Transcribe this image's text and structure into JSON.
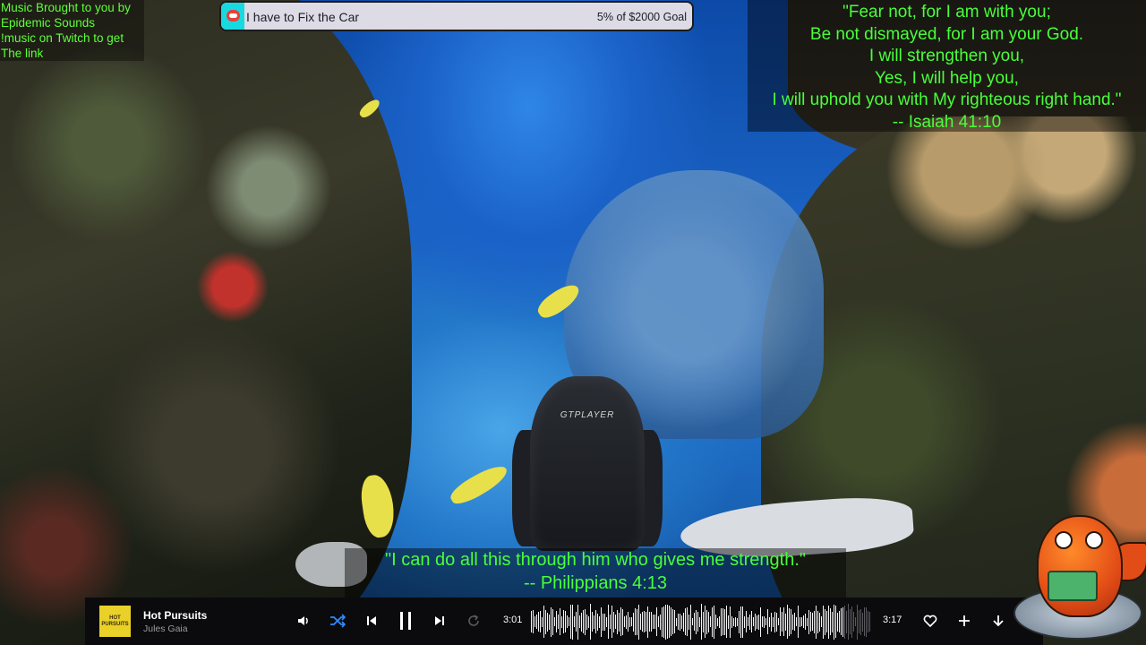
{
  "credits": {
    "lines": [
      "Music Brought to you by",
      "Epidemic Sounds",
      "!music on Twitch to get",
      "The link"
    ]
  },
  "goal": {
    "title": "I have to Fix the Car",
    "progress_text": "5% of $2000 Goal",
    "percent": 5,
    "icon": "heart-chat-icon"
  },
  "verse_top": {
    "lines": [
      "\"Fear not, for I am with you;",
      "Be not dismayed, for I am your God.",
      "I will strengthen you,",
      "Yes, I will help you,",
      "I will uphold you with My righteous right hand.\"",
      "-- Isaiah 41:10"
    ]
  },
  "verse_bottom": {
    "lines": [
      "\"I can do all this through him who gives me strength.\"",
      "-- Philippians 4:13"
    ]
  },
  "chair": {
    "brand": "GTPLAYER"
  },
  "player": {
    "album_art_text": "HOT PURSUITS",
    "song_title": "Hot Pursuits",
    "artist": "Jules Gaia",
    "elapsed": "3:01",
    "duration": "3:17",
    "progress_fraction": 0.92,
    "icons": {
      "volume": "volume-icon",
      "shuffle": "shuffle-icon",
      "previous": "previous-track-icon",
      "pause": "pause-icon",
      "next": "next-track-icon",
      "repeat": "repeat-icon",
      "like": "heart-icon",
      "add": "plus-icon",
      "download": "download-icon"
    }
  },
  "colors": {
    "overlay_text": "#49ff3a",
    "goal_fill": "#19d9e0",
    "shuffle_active": "#2f8cff"
  }
}
